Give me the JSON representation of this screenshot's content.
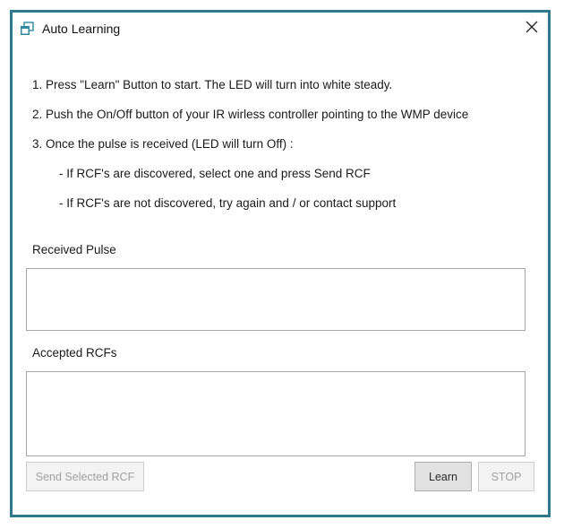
{
  "window": {
    "title": "Auto Learning",
    "icon": "app-window-icon",
    "close_icon": "close-icon"
  },
  "instructions": [
    "1. Press \"Learn\" Button to start. The LED will turn into white steady.",
    "2. Push the On/Off button of your IR wirless controller pointing to the WMP device",
    "3. Once the pulse is received (LED will turn Off) :",
    "- If RCF's are discovered, select one and press Send RCF",
    "- If RCF's are not discovered, try again and / or contact support"
  ],
  "received_pulse": {
    "label": "Received Pulse",
    "items": []
  },
  "accepted_rcfs": {
    "label": "Accepted RCFs",
    "items": []
  },
  "buttons": {
    "send_selected": {
      "label": "Send Selected RCF",
      "enabled": false
    },
    "learn": {
      "label": "Learn",
      "enabled": true
    },
    "stop": {
      "label": "STOP",
      "enabled": false
    }
  },
  "colors": {
    "window_border": "#2e7a8c",
    "icon_accent": "#2e8aa0"
  }
}
